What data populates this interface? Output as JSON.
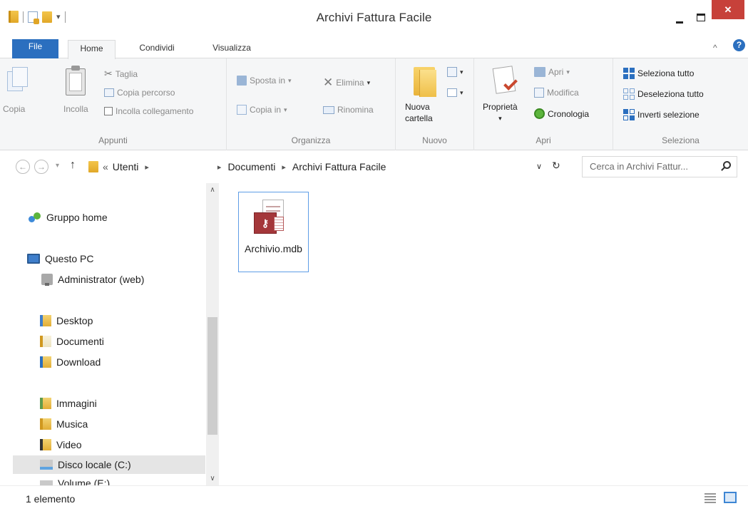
{
  "window": {
    "title": "Archivi Fattura Facile",
    "close_glyph": "✕"
  },
  "ribbon_tabs": {
    "file": "File",
    "home": "Home",
    "share": "Condividi",
    "view": "Visualizza",
    "collapse_glyph": "^",
    "help_glyph": "?"
  },
  "ribbon": {
    "clipboard": {
      "label": "Appunti",
      "copy": "Copia",
      "paste": "Incolla",
      "cut": "Taglia",
      "copy_path": "Copia percorso",
      "paste_shortcut": "Incolla collegamento"
    },
    "organize": {
      "label": "Organizza",
      "move_to": "Sposta in",
      "copy_to": "Copia in",
      "delete": "Elimina",
      "rename": "Rinomina"
    },
    "new": {
      "label": "Nuovo",
      "new_folder_line1": "Nuova",
      "new_folder_line2": "cartella"
    },
    "open": {
      "label": "Apri",
      "properties": "Proprietà",
      "open": "Apri",
      "edit": "Modifica",
      "history": "Cronologia"
    },
    "select": {
      "label": "Seleziona",
      "select_all": "Seleziona tutto",
      "select_none": "Deseleziona tutto",
      "invert": "Inverti selezione"
    }
  },
  "address": {
    "prefix": "«",
    "crumbs": [
      "Utenti",
      "Documenti",
      "Archivi Fattura Facile"
    ],
    "search_placeholder": "Cerca in Archivi Fattur..."
  },
  "nav_pane": {
    "items": [
      {
        "label": "Gruppo home",
        "icon": "homegroup-icon"
      },
      {
        "label": "Questo PC",
        "icon": "pc-icon"
      },
      {
        "label": "Administrator (web)",
        "icon": "network-drive-icon"
      },
      {
        "label": "Desktop",
        "icon": "folder-desktop-icon"
      },
      {
        "label": "Documenti",
        "icon": "folder-documents-icon"
      },
      {
        "label": "Download",
        "icon": "folder-download-icon"
      },
      {
        "label": "Immagini",
        "icon": "folder-pictures-icon"
      },
      {
        "label": "Musica",
        "icon": "folder-music-icon"
      },
      {
        "label": "Video",
        "icon": "folder-video-icon"
      },
      {
        "label": "Disco locale (C:)",
        "icon": "local-disk-icon"
      },
      {
        "label": "Volume (E:)",
        "icon": "volume-icon"
      }
    ],
    "selected": "Disco locale (C:)"
  },
  "files": [
    {
      "name": "Archivio.mdb",
      "icon": "access-database-icon"
    }
  ],
  "status": {
    "count": "1 elemento"
  },
  "colors": {
    "accent": "#2b6fbf",
    "close_button": "#c7413a",
    "selection_border": "#5e9de6"
  }
}
